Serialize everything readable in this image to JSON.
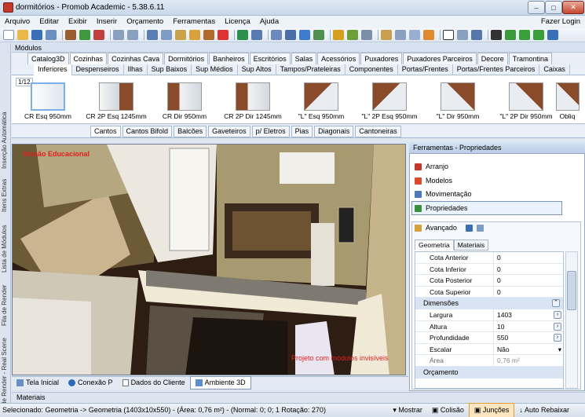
{
  "window": {
    "title": "dormitórios - Promob Academic - 5.38.6.11",
    "min": "–",
    "max": "□",
    "close": "✕"
  },
  "menu": [
    "Arquivo",
    "Editar",
    "Exibir",
    "Inserir",
    "Orçamento",
    "Ferramentas",
    "Licença",
    "Ajuda"
  ],
  "login": "Fazer Login",
  "modules_title": "Módulos",
  "left_panel": [
    "Inserção Automática",
    "Itens Extras",
    "Lista de Módulos",
    "Fila de Render",
    "Fila de Render - Real Scene"
  ],
  "catalog_tabs": {
    "items": [
      "Catalog3D",
      "Cozinhas",
      "Cozinhas Cava",
      "Dormitórios",
      "Banheiros",
      "Escritórios",
      "Salas",
      "Acessórios",
      "Puxadores",
      "Puxadores Parceiros",
      "Decore",
      "Tramontina"
    ],
    "active": 1
  },
  "sub_tabs": {
    "items": [
      "Inferiores",
      "Despenseiros",
      "Ilhas",
      "Sup Baixos",
      "Sup Médios",
      "Sup Altos",
      "Tampos/Prateleiras",
      "Componentes",
      "Portas/Frentes",
      "Portas/Frentes Parceiros",
      "Caixas"
    ],
    "active": 0
  },
  "page_indicator": "1/12",
  "catalog_items": [
    {
      "label": "CR Esq 950mm",
      "icon": "corner-cabinet-white-icon"
    },
    {
      "label": "CR 2P Esq 1245mm",
      "icon": "corner-cabinet-white-icon"
    },
    {
      "label": "CR Dir 950mm",
      "icon": "corner-cabinet-wood-icon"
    },
    {
      "label": "CR 2P Dir 1245mm",
      "icon": "corner-cabinet-wood-icon"
    },
    {
      "label": "\"L\" Esq 950mm",
      "icon": "l-cabinet-icon"
    },
    {
      "label": "\"L\" 2P Esq 950mm",
      "icon": "l-cabinet-icon"
    },
    {
      "label": "\"L\" Dir 950mm",
      "icon": "l-cabinet-icon"
    },
    {
      "label": "\"L\" 2P Dir 950mm",
      "icon": "l-cabinet-icon"
    },
    {
      "label": "Obliq",
      "icon": "l-cabinet-icon"
    }
  ],
  "corner_tabs": {
    "items": [
      "Cantos",
      "Cantos Bifold",
      "Balcões",
      "Gaveteiros",
      "p/ Eletros",
      "Pias",
      "Diagonais",
      "Cantoneiras"
    ],
    "active": 0
  },
  "viewport": {
    "overlay_top": "Versão Educacional",
    "overlay_bottom": "Projeto com módulos invisíveis"
  },
  "bottom_tabs": {
    "items": [
      "Tela Inicial",
      "Conexão P",
      "Dados do Cliente",
      "Ambiente 3D"
    ],
    "active": 3
  },
  "materials_bar": "Materiais",
  "status": {
    "text": "Selecionado: Geometria -> Geometria (1403x10x550) - (Área: 0,76 m²) - (Normal: 0; 0; 1 Rotação: 270)",
    "mostrar": "Mostrar",
    "colisao": "Colisão",
    "juncoes": "Junções",
    "auto_rebaixar": "Auto Rebaixar"
  },
  "right_panel": {
    "title": "Ferramentas - Propriedades",
    "items": [
      "Arranjo",
      "Modelos",
      "Movimentação",
      "Propriedades"
    ],
    "advanced": "Avançado",
    "tabs": [
      "Geometria",
      "Materiais"
    ],
    "rows_top": [
      {
        "name": "Cota Anterior",
        "value": "0"
      },
      {
        "name": "Cota Inferior",
        "value": "0"
      },
      {
        "name": "Cota Posterior",
        "value": "0"
      },
      {
        "name": "Cota Superior",
        "value": "0"
      }
    ],
    "dim_section": "Dimensões",
    "rows_dim": [
      {
        "name": "Largura",
        "value": "1403"
      },
      {
        "name": "Altura",
        "value": "10"
      },
      {
        "name": "Profundidade",
        "value": "550"
      },
      {
        "name": "Escalar",
        "value": "Não"
      },
      {
        "name": "Área",
        "value": "0,76 m²"
      }
    ],
    "next_section": "Orçamento"
  }
}
